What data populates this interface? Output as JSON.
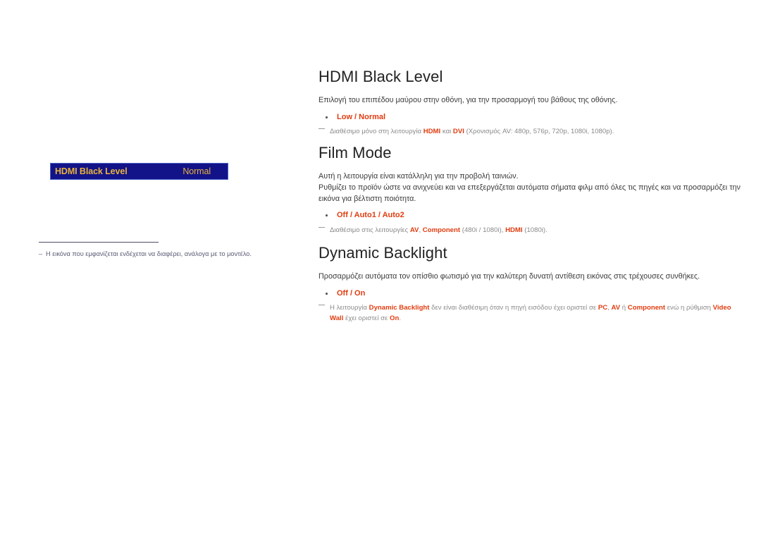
{
  "left_panel": {
    "osd": {
      "label": "HDMI Black Level",
      "value": "Normal",
      "bg_color": "#131389",
      "border_color": "#4a63c8",
      "text_color": "#e8b33a"
    },
    "footnote": {
      "dash": "–",
      "text": "Η εικόνα που εμφανίζεται ενδέχεται να διαφέρει, ανάλογα με το μοντέλο."
    }
  },
  "sections": {
    "hdmi_black_level": {
      "title": "HDMI Black Level",
      "description": "Επιλογή του επιπέδου μαύρου στην οθόνη, για την προσαρμογή του βάθους της οθόνης.",
      "options": "Low / Normal",
      "note": {
        "p1": "Διαθέσιμο μόνο στη λειτουργία ",
        "kw1": "HDMI",
        "p2": " και ",
        "kw2": "DVI",
        "p3": " (Χρονισμός AV: 480p, 576p, 720p, 1080i, 1080p)."
      }
    },
    "film_mode": {
      "title": "Film Mode",
      "description1": "Αυτή η λειτουργία είναι κατάλληλη για την προβολή ταινιών.",
      "description2": "Ρυθμίζει το προϊόν ώστε να ανιχνεύει και να επεξεργάζεται αυτόματα σήματα φιλμ από όλες τις πηγές και να προσαρμόζει την εικόνα για βέλτιστη ποιότητα.",
      "options": "Off / Auto1 / Auto2",
      "note": {
        "p1": "Διαθέσιμο στις λειτουργίες ",
        "kw1": "AV",
        "p2": ", ",
        "kw2": "Component",
        "p3": " (480i / 1080i), ",
        "kw3": "HDMI",
        "p4": " (1080i)."
      }
    },
    "dynamic_backlight": {
      "title": "Dynamic Backlight",
      "description": "Προσαρμόζει αυτόματα τον οπίσθιο φωτισμό για την καλύτερη δυνατή αντίθεση εικόνας στις τρέχουσες συνθήκες.",
      "options": "Off / On",
      "note": {
        "p1": "Η λειτουργία ",
        "kw1": "Dynamic Backlight",
        "p2": " δεν είναι διαθέσιμη όταν η πηγή εισόδου έχει οριστεί σε ",
        "kw2": "PC",
        "p3": ", ",
        "kw3": "AV",
        "p4": " ή ",
        "kw4": "Component",
        "p5": " ενώ η ρύθμιση ",
        "kw5": "Video Wall",
        "p6": " έχει οριστεί σε ",
        "kw6": "On",
        "p7": "."
      }
    }
  },
  "theme": {
    "accent_red": "#e03c10",
    "note_gray": "#8a8a8a",
    "body_gray": "#3a3a3a",
    "heading": "#222222"
  }
}
